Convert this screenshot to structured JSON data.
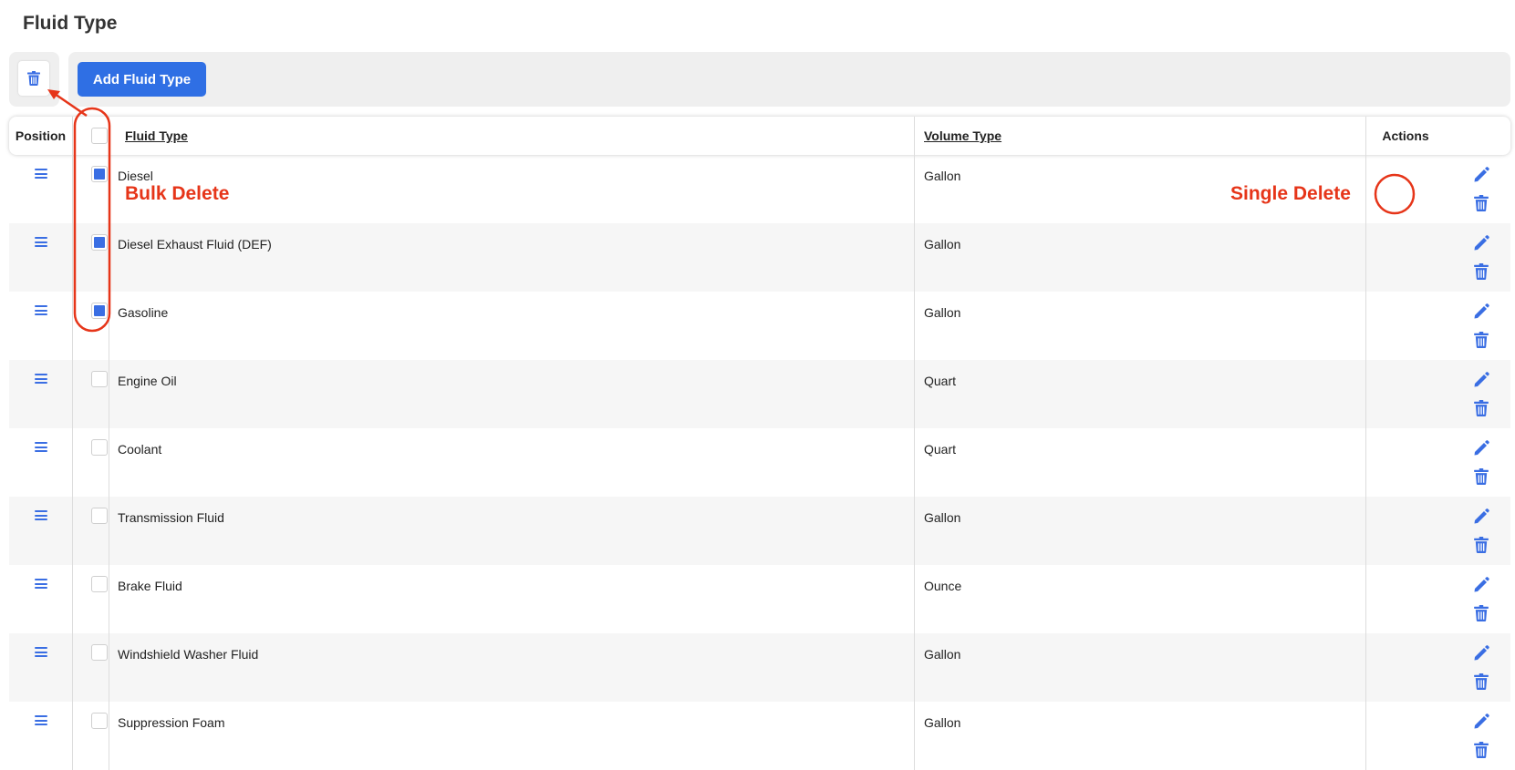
{
  "page": {
    "title": "Fluid Type"
  },
  "toolbar": {
    "add_label": "Add Fluid Type"
  },
  "table": {
    "headers": {
      "position": "Position",
      "fluid_type": "Fluid Type",
      "volume_type": "Volume Type",
      "actions": "Actions"
    },
    "rows": [
      {
        "fluid_type": "Diesel",
        "volume_type": "Gallon",
        "selected": true
      },
      {
        "fluid_type": "Diesel Exhaust Fluid (DEF)",
        "volume_type": "Gallon",
        "selected": true
      },
      {
        "fluid_type": "Gasoline",
        "volume_type": "Gallon",
        "selected": true
      },
      {
        "fluid_type": "Engine Oil",
        "volume_type": "Quart",
        "selected": false
      },
      {
        "fluid_type": "Coolant",
        "volume_type": "Quart",
        "selected": false
      },
      {
        "fluid_type": "Transmission Fluid",
        "volume_type": "Gallon",
        "selected": false
      },
      {
        "fluid_type": "Brake Fluid",
        "volume_type": "Ounce",
        "selected": false
      },
      {
        "fluid_type": "Windshield Washer Fluid",
        "volume_type": "Gallon",
        "selected": false
      },
      {
        "fluid_type": "Suppression Foam",
        "volume_type": "Gallon",
        "selected": false
      }
    ]
  },
  "annotations": {
    "bulk_delete": "Bulk Delete",
    "single_delete": "Single Delete"
  },
  "icons": {
    "drag": "drag-handle-icon",
    "edit": "pencil-icon",
    "delete": "trash-icon"
  },
  "colors": {
    "accent": "#3a6ee3",
    "button": "#2f6fe4",
    "annotation": "#e63519"
  }
}
